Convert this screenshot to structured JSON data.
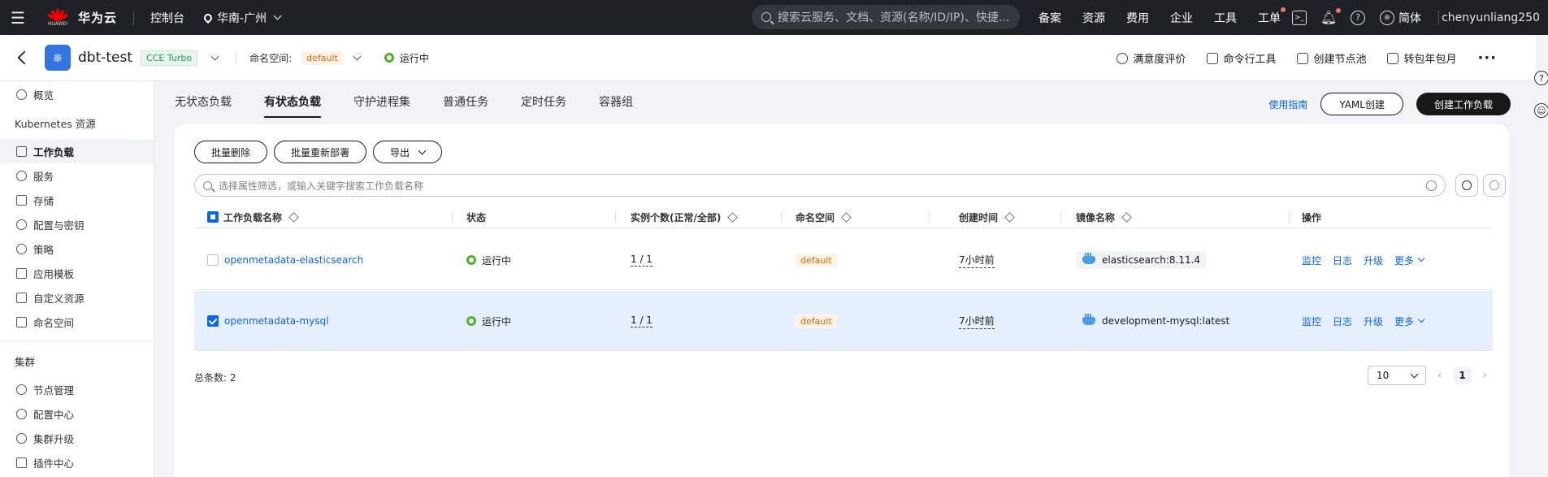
{
  "topbar": {
    "brand": "华为云",
    "brand_sub": "HUAWEI",
    "console": "控制台",
    "region": "华南-广州",
    "search_placeholder": "搜索云服务、文档、资源(名称/ID/IP)、快捷...",
    "nav": [
      "备案",
      "资源",
      "费用",
      "企业",
      "工具",
      "工单"
    ],
    "language": "简体",
    "username": "chenyunliang250"
  },
  "cluster": {
    "name": "dbt-test",
    "type_tag": "CCE Turbo",
    "namespace_label": "命名空间:",
    "namespace": "default",
    "status": "运行中",
    "actions": [
      "满意度评价",
      "命令行工具",
      "创建节点池",
      "转包年包月"
    ],
    "more": "···"
  },
  "sidebar": {
    "overview": "概览",
    "group_k8s": "Kubernetes 资源",
    "k8s_items": [
      "工作负载",
      "服务",
      "存储",
      "配置与密钥",
      "策略",
      "应用模板",
      "自定义资源",
      "命名空间"
    ],
    "group_cluster": "集群",
    "cluster_items": [
      "节点管理",
      "配置中心",
      "集群升级",
      "插件中心"
    ]
  },
  "tabs": [
    "无状态负载",
    "有状态负载",
    "守护进程集",
    "普通任务",
    "定时任务",
    "容器组"
  ],
  "tab_actions": {
    "guide": "使用指南",
    "yaml": "YAML创建",
    "create": "创建工作负载"
  },
  "toolbar": {
    "batch_delete": "批量删除",
    "batch_redeploy": "批量重新部署",
    "export": "导出"
  },
  "filter_placeholder": "选择属性筛选，或输入关键字搜索工作负载名称",
  "table": {
    "headers": [
      "工作负载名称",
      "状态",
      "实例个数(正常/全部)",
      "命名空间",
      "创建时间",
      "镜像名称",
      "操作"
    ],
    "rows": [
      {
        "name": "openmetadata-elasticsearch",
        "status": "运行中",
        "instances": "1 / 1",
        "namespace": "default",
        "created": "7小时前",
        "image": "elasticsearch:8.11.4",
        "selected": false
      },
      {
        "name": "openmetadata-mysql",
        "status": "运行中",
        "instances": "1 / 1",
        "namespace": "default",
        "created": "7小时前",
        "image": "development-mysql:latest",
        "selected": true
      }
    ],
    "ops": [
      "监控",
      "日志",
      "升级",
      "更多"
    ]
  },
  "footer": {
    "total": "总条数: 2",
    "page_size": "10",
    "current_page": "1"
  }
}
